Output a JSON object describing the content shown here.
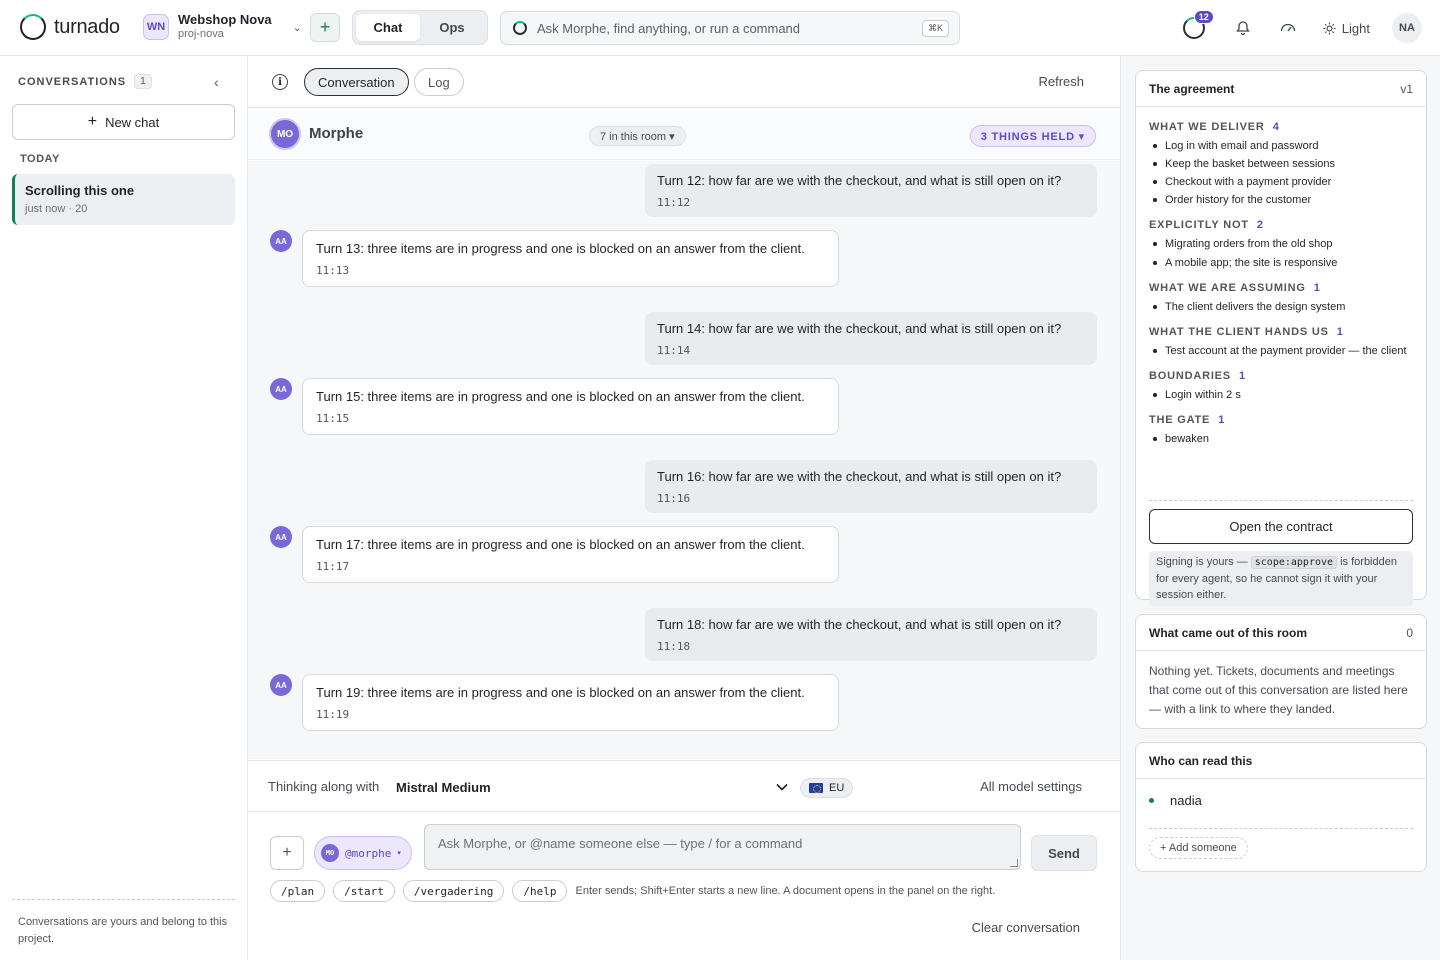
{
  "app": {
    "logo_text": "turnado"
  },
  "project": {
    "badge": "WN",
    "name": "Webshop Nova",
    "slug": "proj-nova"
  },
  "mode_tabs": [
    "Chat",
    "Ops"
  ],
  "search": {
    "placeholder": "Ask Morphe, find anything, or run a command",
    "shortcut": "⌘K"
  },
  "topbar": {
    "notifications_count": "12",
    "theme_label": "Light",
    "user_initials": "NA"
  },
  "sidebar": {
    "title": "CONVERSATIONS",
    "count": "1",
    "new_chat_label": "New chat",
    "section_today": "TODAY",
    "conversations": [
      {
        "title": "Scrolling this one",
        "meta": "just now · 20"
      }
    ],
    "footer": "Conversations are yours and belong to this project."
  },
  "main": {
    "tabs": [
      "Conversation",
      "Log"
    ],
    "refresh_label": "Refresh",
    "room": {
      "avatar": "MO",
      "name": "Morphe",
      "members": "7 in this room ▾",
      "held": "3 THINGS HELD ▾"
    },
    "messages": [
      {
        "role": "user",
        "text": "Turn 12: how far are we with the checkout, and what is still open on it?",
        "time": "11:12"
      },
      {
        "role": "agent",
        "avatar": "AA",
        "text": "Turn 13: three items are in progress and one is blocked on an answer from the client.",
        "time": "11:13"
      },
      {
        "role": "user",
        "text": "Turn 14: how far are we with the checkout, and what is still open on it?",
        "time": "11:14"
      },
      {
        "role": "agent",
        "avatar": "AA",
        "text": "Turn 15: three items are in progress and one is blocked on an answer from the client.",
        "time": "11:15"
      },
      {
        "role": "user",
        "text": "Turn 16: how far are we with the checkout, and what is still open on it?",
        "time": "11:16"
      },
      {
        "role": "agent",
        "avatar": "AA",
        "text": "Turn 17: three items are in progress and one is blocked on an answer from the client.",
        "time": "11:17"
      },
      {
        "role": "user",
        "text": "Turn 18: how far are we with the checkout, and what is still open on it?",
        "time": "11:18"
      },
      {
        "role": "agent",
        "avatar": "AA",
        "text": "Turn 19: three items are in progress and one is blocked on an answer from the client.",
        "time": "11:19"
      }
    ],
    "model_bar": {
      "label": "Thinking along with",
      "model": "Mistral Medium",
      "region": "EU",
      "settings_label": "All model settings"
    },
    "composer": {
      "mention_avatar": "MO",
      "mention": "@morphe",
      "placeholder": "Ask Morphe, or @name someone else — type / for a command",
      "send_label": "Send",
      "commands": [
        "/plan",
        "/start",
        "/vergadering",
        "/help"
      ],
      "hint": "Enter sends; Shift+Enter starts a new line. A document opens in the panel on the right.",
      "clear_label": "Clear conversation"
    }
  },
  "agreement": {
    "title": "The agreement",
    "version": "v1",
    "sections": [
      {
        "heading": "WHAT WE DELIVER",
        "count": "4",
        "items": [
          "Log in with email and password",
          "Keep the basket between sessions",
          "Checkout with a payment provider",
          "Order history for the customer"
        ]
      },
      {
        "heading": "EXPLICITLY NOT",
        "count": "2",
        "items": [
          "Migrating orders from the old shop",
          "A mobile app; the site is responsive"
        ]
      },
      {
        "heading": "WHAT WE ARE ASSUMING",
        "count": "1",
        "items": [
          "The client delivers the design system"
        ]
      },
      {
        "heading": "WHAT THE CLIENT HANDS US",
        "count": "1",
        "items": [
          "Test account at the payment provider — the client"
        ]
      },
      {
        "heading": "BOUNDARIES",
        "count": "1",
        "items": [
          "Login within 2 s"
        ]
      },
      {
        "heading": "THE GATE",
        "count": "1",
        "items": [
          "bewaken"
        ]
      }
    ],
    "open_label": "Open the contract",
    "note_before": "Signing is yours — ",
    "note_code": "scope:approve",
    "note_after": " is forbidden for every agent, so he cannot sign it with your session either."
  },
  "outcomes": {
    "title": "What came out of this room",
    "count": "0",
    "body": "Nothing yet. Tickets, documents and meetings that come out of this conversation are listed here — with a link to where they landed."
  },
  "readers": {
    "title": "Who can read this",
    "people": [
      "nadia"
    ],
    "add_label": "+ Add someone"
  }
}
